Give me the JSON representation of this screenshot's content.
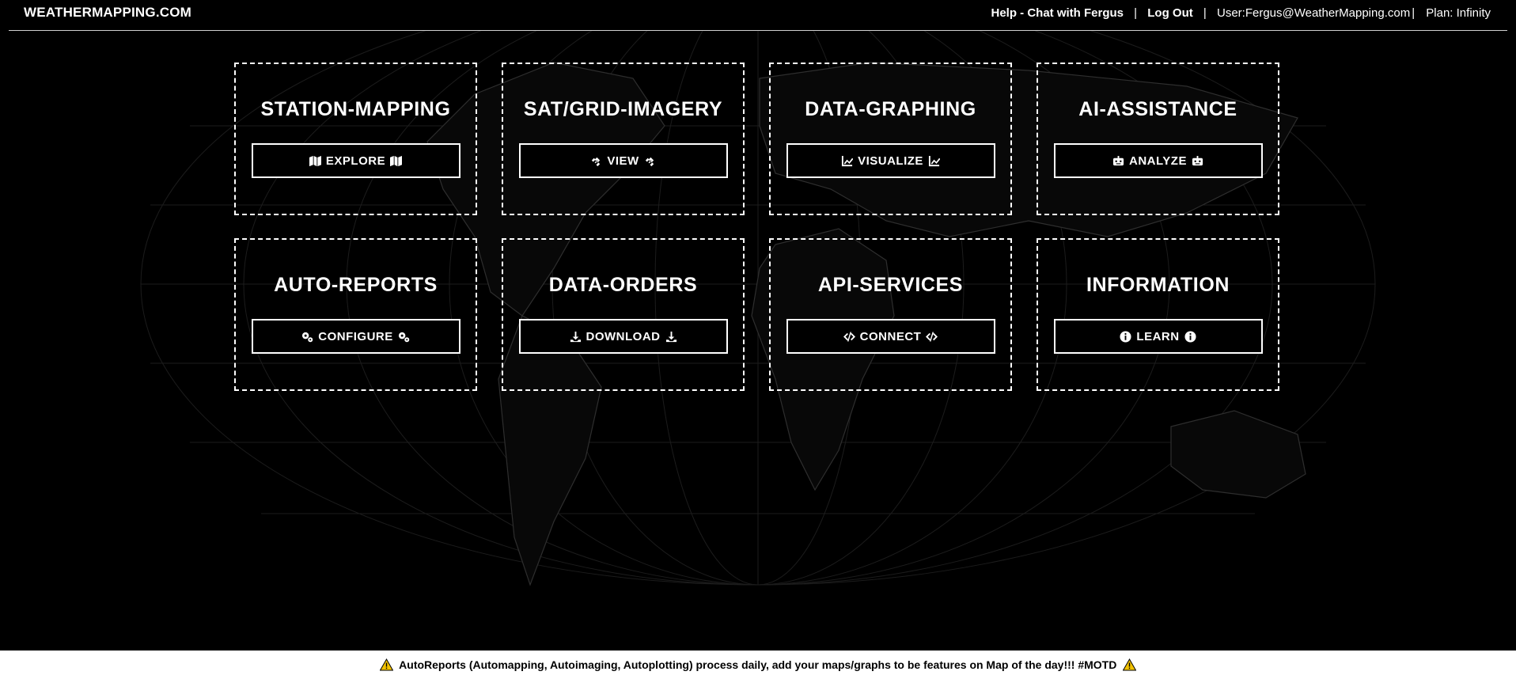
{
  "header": {
    "brand": "WEATHERMAPPING.COM",
    "help_label": "Help - Chat with Fergus",
    "separator": "|",
    "logout_label": "Log Out",
    "user_label": "User:Fergus@WeatherMapping.com",
    "plan_label": "Plan: Infinity"
  },
  "cards": [
    {
      "title": "STATION-MAPPING",
      "button": "EXPLORE",
      "icon": "map-icon"
    },
    {
      "title": "SAT/GRID-IMAGERY",
      "button": "VIEW",
      "icon": "satellite-icon"
    },
    {
      "title": "DATA-GRAPHING",
      "button": "VISUALIZE",
      "icon": "line-chart-icon"
    },
    {
      "title": "AI-ASSISTANCE",
      "button": "ANALYZE",
      "icon": "robot-icon"
    },
    {
      "title": "AUTO-REPORTS",
      "button": "CONFIGURE",
      "icon": "gears-icon"
    },
    {
      "title": "DATA-ORDERS",
      "button": "DOWNLOAD",
      "icon": "download-icon"
    },
    {
      "title": "API-SERVICES",
      "button": "CONNECT",
      "icon": "code-icon"
    },
    {
      "title": "INFORMATION",
      "button": "LEARN",
      "icon": "info-circle-icon"
    }
  ],
  "footer": {
    "message": "AutoReports (Automapping, Autoimaging, Autoplotting) process daily, add your maps/graphs to be features on Map of the day!!! #MOTD",
    "icon": "warning-icon"
  },
  "colors": {
    "background": "#000000",
    "foreground": "#ffffff",
    "footer_bg": "#ffffff",
    "warning": "#f2c200"
  }
}
